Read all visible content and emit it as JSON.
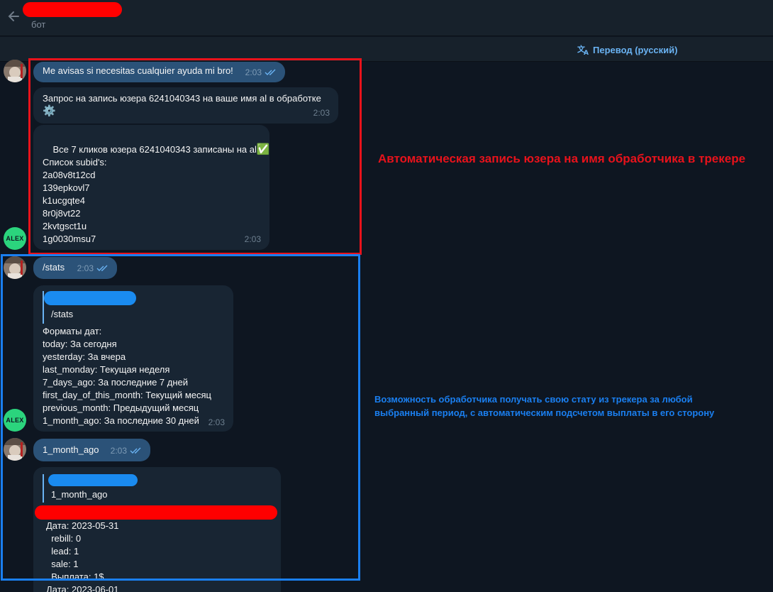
{
  "header": {
    "subtitle": "бот"
  },
  "translate": {
    "label": "Перевод (русский)"
  },
  "avatar_alex": "ALEX",
  "messages": {
    "m1": {
      "text": "Me avisas si necesitas cualquier ayuda mi bro!",
      "time": "2:03"
    },
    "m2": {
      "text": "Запрос на запись юзера 6241040343 на ваше имя al в обработке",
      "emoji": "⚙️",
      "time": "2:03"
    },
    "m3": {
      "line1": "Все 7 кликов юзера 6241040343 записаны на al",
      "emoji": "✅",
      "list_title": "Список subid's:",
      "subids": [
        "2a08v8t12cd",
        "139epkovl7",
        "k1ucgqte4",
        "8r0j8vt22",
        "2kvtgsct1u",
        "1g0030msu7"
      ],
      "time": "2:03"
    },
    "m4": {
      "text": "/stats",
      "time": "2:03"
    },
    "m5": {
      "quote": "/stats",
      "lines": [
        "Форматы дат:",
        "today: За сегодня",
        "yesterday: За вчера",
        "last_monday: Текущая неделя",
        "7_days_ago: За последние 7 дней",
        "first_day_of_this_month: Текущий месяц",
        "previous_month: Предыдущий месяц",
        "1_month_ago: За последние 30 дней"
      ],
      "time": "2:03"
    },
    "m6": {
      "text": "1_month_ago",
      "time": "2:03"
    },
    "m7": {
      "quote": "1_month_ago",
      "lines": [
        "Дата: 2023-05-31",
        "  rebill: 0",
        "  lead: 1",
        "  sale: 1",
        "  Выплата: 1$",
        "Дата: 2023-06-01"
      ]
    }
  },
  "annotations": {
    "red": "Автоматическая запись юзера на имя обработчика в трекере",
    "blue": "Возможность обработчика получать свою стату из трекера за любой\nвыбранный период, с автоматическим подсчетом выплаты в его сторону"
  },
  "colors": {
    "background": "#0e1621",
    "outgoing_bubble": "#2b5278",
    "incoming_bubble": "#182533",
    "accent": "#6ab3f3",
    "annotation_red": "#e8121b",
    "annotation_blue": "#1a7ff0"
  }
}
